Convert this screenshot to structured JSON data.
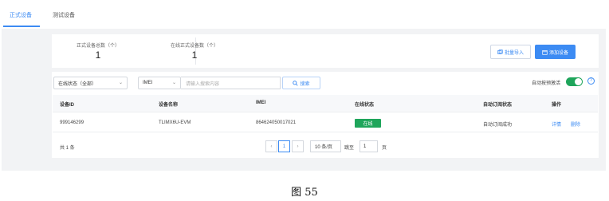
{
  "tabs": [
    {
      "label": "正式设备",
      "active": true
    },
    {
      "label": "测试设备",
      "active": false
    }
  ],
  "stats": {
    "device_total_label": "正式设备总数（个）",
    "device_total_value": "1",
    "online_total_label": "在线正式设备数（个）",
    "online_total_value": "1"
  },
  "actions": {
    "bulk_import_label": "批量导入",
    "add_device_label": "添加设备"
  },
  "filters": {
    "status_select": "在线状态（全部）",
    "field_select": "IMEI",
    "search_placeholder": "请输入搜索内容",
    "search_button": "搜索",
    "auto_subscribe_label": "自动按预激活",
    "help_glyph": "?"
  },
  "table": {
    "columns": [
      "设备ID",
      "设备名称",
      "IMEI",
      "在线状态",
      "自动订阅状态",
      "操作"
    ],
    "rows": [
      {
        "device_id": "999146299",
        "device_name": "TLIMX6U-EVM",
        "imei": "864624050017021",
        "online_status": "在线",
        "subscribe_status": "自动订阅成功",
        "action_detail": "详情",
        "action_delete": "删除"
      }
    ]
  },
  "pagination": {
    "total_text": "共 1 条",
    "prev_glyph": "‹",
    "current_page": "1",
    "next_glyph": "›",
    "page_size": "10 条/页",
    "jump_label": "跳至",
    "jump_value": "1",
    "page_unit": "页"
  },
  "caption": "图 55",
  "colors": {
    "accent": "#3c8bf3",
    "online": "#1fa55b",
    "background": "#f2f3f5"
  }
}
